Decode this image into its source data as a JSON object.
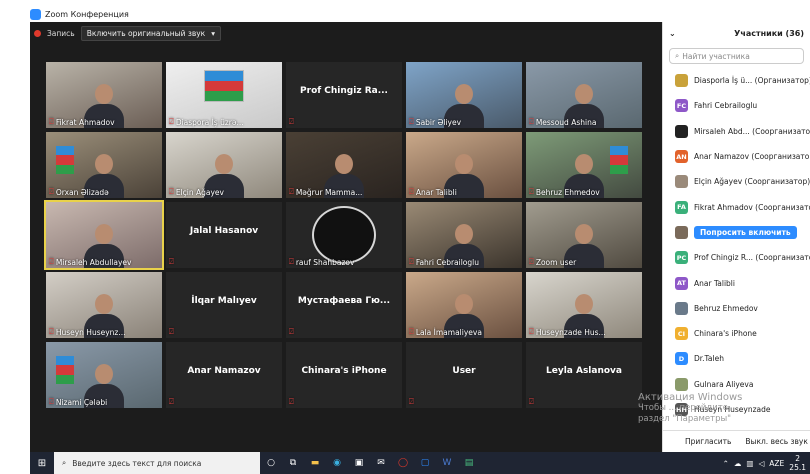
{
  "window": {
    "title": "Zoom Конференция"
  },
  "toolbar": {
    "record_label": "Запись",
    "original_sound_label": "Включить оригинальный звук"
  },
  "tiles": [
    {
      "name": "Fikrat Ahmadov",
      "video": true
    },
    {
      "name": "Diaspora İş üzrə...",
      "video": true
    },
    {
      "name": "Prof Chingiz Ra...",
      "video": false
    },
    {
      "name": "Sabir Əliyev",
      "video": true
    },
    {
      "name": "Messoud Ashina",
      "video": true
    },
    {
      "name": "Orxan Əlizadə",
      "video": true
    },
    {
      "name": "Elçin Ağayev",
      "video": true
    },
    {
      "name": "Məğrur Mamma...",
      "video": true
    },
    {
      "name": "Anar Talibli",
      "video": true
    },
    {
      "name": "Behruz Ehmedov",
      "video": true
    },
    {
      "name": "Mirsaleh Abdullayev",
      "video": true
    },
    {
      "name": "Jalal Hasanov",
      "video": false
    },
    {
      "name": "rauf Shahbazov",
      "video": true
    },
    {
      "name": "Fahri Cebrailoglu",
      "video": true
    },
    {
      "name": "Zoom user",
      "video": true
    },
    {
      "name": "Huseyn Huseynz...",
      "video": true
    },
    {
      "name": "İlqar Malıyev",
      "video": false
    },
    {
      "name": "Мустафаева Гю...",
      "video": false
    },
    {
      "name": "Lala İmamaliyeva",
      "video": true
    },
    {
      "name": "Huseynzade Hus...",
      "video": true
    },
    {
      "name": "Nizami Çələbi",
      "video": true
    },
    {
      "name": "Anar Namazov",
      "video": false
    },
    {
      "name": "Chinara's iPhone",
      "video": false
    },
    {
      "name": "User",
      "video": false
    },
    {
      "name": "Leyla Aslanova",
      "video": false
    }
  ],
  "participants_panel": {
    "title": "Участники (36)",
    "search_placeholder": "Найти участника",
    "participants": [
      {
        "initials": "",
        "name": "Diasporla İş ü... (Организатор)",
        "color": "#c9a23a"
      },
      {
        "initials": "FC",
        "name": "Fahri Cebrailoglu",
        "color": "#8e58c8"
      },
      {
        "initials": "",
        "name": "Mirsaleh Abd... (Соорганизатор)",
        "color": "#222222"
      },
      {
        "initials": "AN",
        "name": "Anar Namazov (Соорганизатор)",
        "color": "#e2622b"
      },
      {
        "initials": "",
        "name": "Elçin Ağayev (Соорганизатор)",
        "color": "#9a8a7a"
      },
      {
        "initials": "FA",
        "name": "Fikrat Ahmadov (Соорганизатор)",
        "color": "#3ab07a"
      },
      {
        "initials": "",
        "name": "",
        "color": "#7a6a5a",
        "action": "Попросить включить"
      },
      {
        "initials": "PC",
        "name": "Prof Chingiz R... (Соорганизатор)",
        "color": "#3ab07a"
      },
      {
        "initials": "AT",
        "name": "Anar Talibli",
        "color": "#8e58c8"
      },
      {
        "initials": "",
        "name": "Behruz Ehmedov",
        "color": "#6a7a8a"
      },
      {
        "initials": "CI",
        "name": "Chinara's iPhone",
        "color": "#f0b030"
      },
      {
        "initials": "D",
        "name": "Dr.Taleh",
        "color": "#2d8cff"
      },
      {
        "initials": "",
        "name": "Gulnara Aliyeva",
        "color": "#8a9a6a"
      },
      {
        "initials": "HH",
        "name": "Huseyn Huseynzade",
        "color": "#555555"
      }
    ],
    "invite_label": "Пригласить",
    "mute_all_label": "Выкл. весь звук"
  },
  "watermark": {
    "line1": "Активация Windows",
    "line2": "Чтобы ... перейдите",
    "line3": "раздел \"Параметры\""
  },
  "taskbar": {
    "search_placeholder": "Введите здесь текст для поиска",
    "lang": "AZE",
    "time": "2",
    "date": "25.1"
  }
}
